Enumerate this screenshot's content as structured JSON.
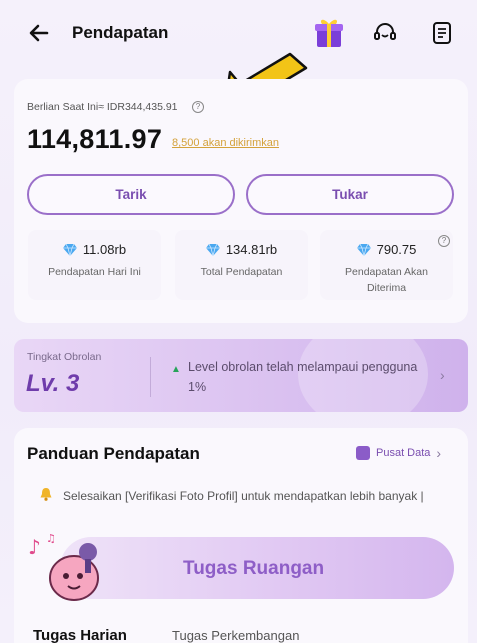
{
  "header": {
    "title": "Pendapatan",
    "icons": [
      "back-arrow-icon",
      "gift-icon",
      "headset-icon",
      "document-icon"
    ]
  },
  "balance": {
    "label": "Berlian Saat Ini≈ IDR344,435.91",
    "value": "114,811.97",
    "pending": "8,500 akan dikirimkan"
  },
  "actions": {
    "withdraw": "Tarik",
    "exchange": "Tukar"
  },
  "stats": [
    {
      "value": "11.08rb",
      "label": "Pendapatan Hari Ini"
    },
    {
      "value": "134.81rb",
      "label": "Total Pendapatan"
    },
    {
      "value": "790.75",
      "label": "Pendapatan Akan Diterima"
    }
  ],
  "level": {
    "label": "Tingkat Obrolan",
    "value": "Lv. 3",
    "text": "Level obrolan telah melampaui pengguna 1%"
  },
  "guide": {
    "title": "Panduan Pendapatan",
    "link": "Pusat Data",
    "notice": "Selesaikan [Verifikasi Foto Profil] untuk mendapatkan lebih banyak |",
    "task_button": "Tugas Ruangan"
  },
  "tabs": [
    "Tugas Harian",
    "Tugas Perkembangan"
  ],
  "colors": {
    "accent": "#8e5ec7",
    "pending": "#d4a23a",
    "annotation_arrow": "#f2c417"
  }
}
